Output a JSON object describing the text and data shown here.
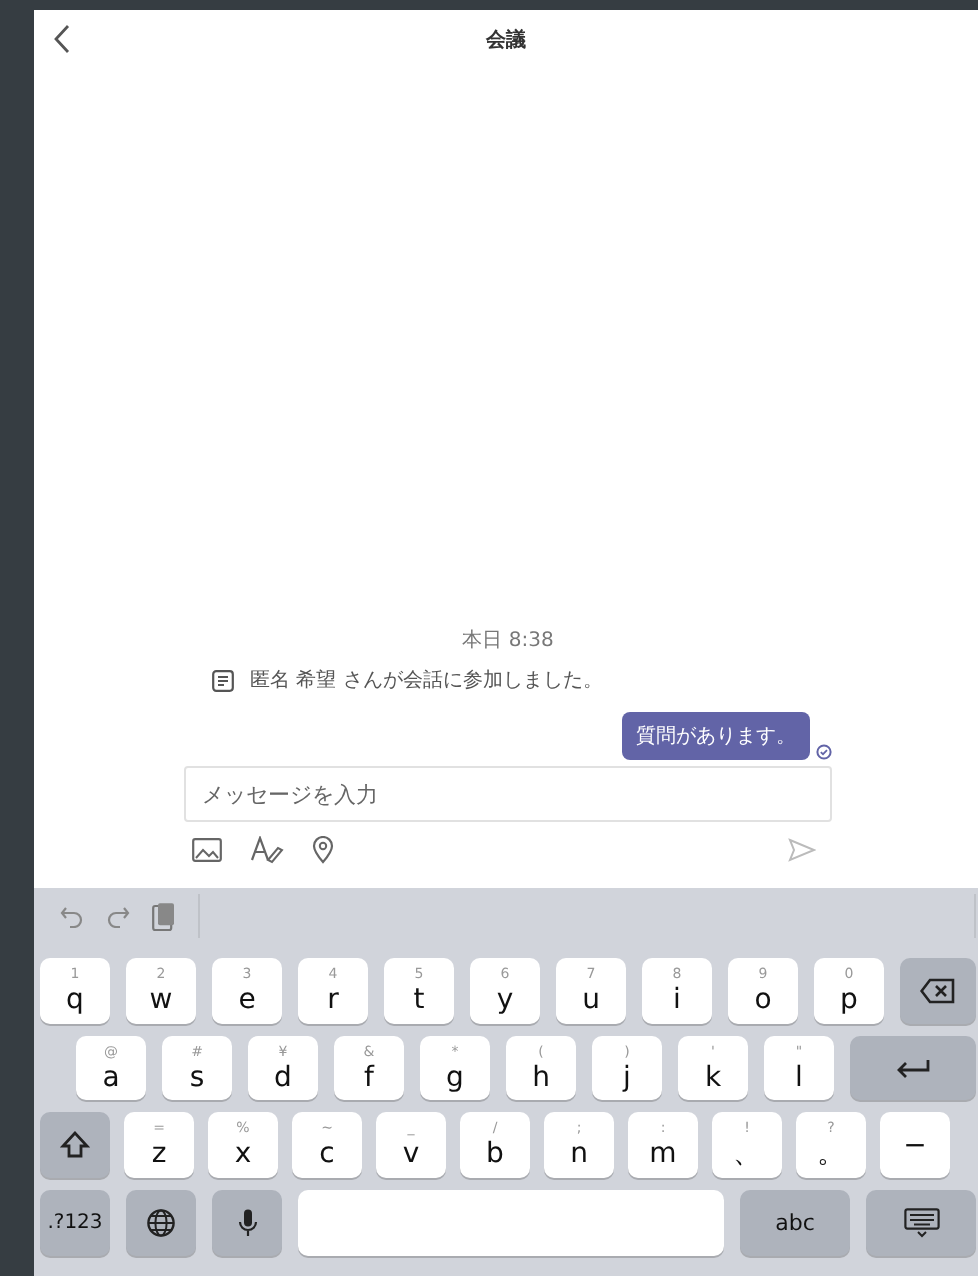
{
  "header": {
    "title": "会議"
  },
  "chat": {
    "timestamp": "本日 8:38",
    "notice": "匿名 希望 さんが会話に参加しました。",
    "message": "質問があります。"
  },
  "composer": {
    "placeholder": "メッセージを入力"
  },
  "keyboard": {
    "rows": [
      [
        {
          "kind": "letter",
          "hint": "1",
          "label": "q"
        },
        {
          "kind": "letter",
          "hint": "2",
          "label": "w"
        },
        {
          "kind": "letter",
          "hint": "3",
          "label": "e"
        },
        {
          "kind": "letter",
          "hint": "4",
          "label": "r"
        },
        {
          "kind": "letter",
          "hint": "5",
          "label": "t"
        },
        {
          "kind": "letter",
          "hint": "6",
          "label": "y"
        },
        {
          "kind": "letter",
          "hint": "7",
          "label": "u"
        },
        {
          "kind": "letter",
          "hint": "8",
          "label": "i"
        },
        {
          "kind": "letter",
          "hint": "9",
          "label": "o"
        },
        {
          "kind": "letter",
          "hint": "0",
          "label": "p"
        },
        {
          "kind": "backspace"
        }
      ],
      [
        {
          "kind": "letter",
          "hint": "@",
          "label": "a"
        },
        {
          "kind": "letter",
          "hint": "#",
          "label": "s"
        },
        {
          "kind": "letter",
          "hint": "¥",
          "label": "d"
        },
        {
          "kind": "letter",
          "hint": "&",
          "label": "f"
        },
        {
          "kind": "letter",
          "hint": "*",
          "label": "g"
        },
        {
          "kind": "letter",
          "hint": "(",
          "label": "h"
        },
        {
          "kind": "letter",
          "hint": ")",
          "label": "j"
        },
        {
          "kind": "letter",
          "hint": "'",
          "label": "k"
        },
        {
          "kind": "letter",
          "hint": "\"",
          "label": "l"
        },
        {
          "kind": "return"
        }
      ],
      [
        {
          "kind": "shift"
        },
        {
          "kind": "letter",
          "hint": "=",
          "label": "z"
        },
        {
          "kind": "letter",
          "hint": "%",
          "label": "x"
        },
        {
          "kind": "letter",
          "hint": "~",
          "label": "c"
        },
        {
          "kind": "letter",
          "hint": "_",
          "label": "v"
        },
        {
          "kind": "letter",
          "hint": "/",
          "label": "b"
        },
        {
          "kind": "letter",
          "hint": ";",
          "label": "n"
        },
        {
          "kind": "letter",
          "hint": ":",
          "label": "m"
        },
        {
          "kind": "letter",
          "hint": "!",
          "label": "、"
        },
        {
          "kind": "letter",
          "hint": "?",
          "label": "。"
        },
        {
          "kind": "letter",
          "label": "−"
        }
      ],
      [
        {
          "kind": "numbers",
          "label": ".?123"
        },
        {
          "kind": "globe"
        },
        {
          "kind": "mic"
        },
        {
          "kind": "space"
        },
        {
          "kind": "abc",
          "label": "abc"
        },
        {
          "kind": "hide"
        }
      ]
    ]
  }
}
